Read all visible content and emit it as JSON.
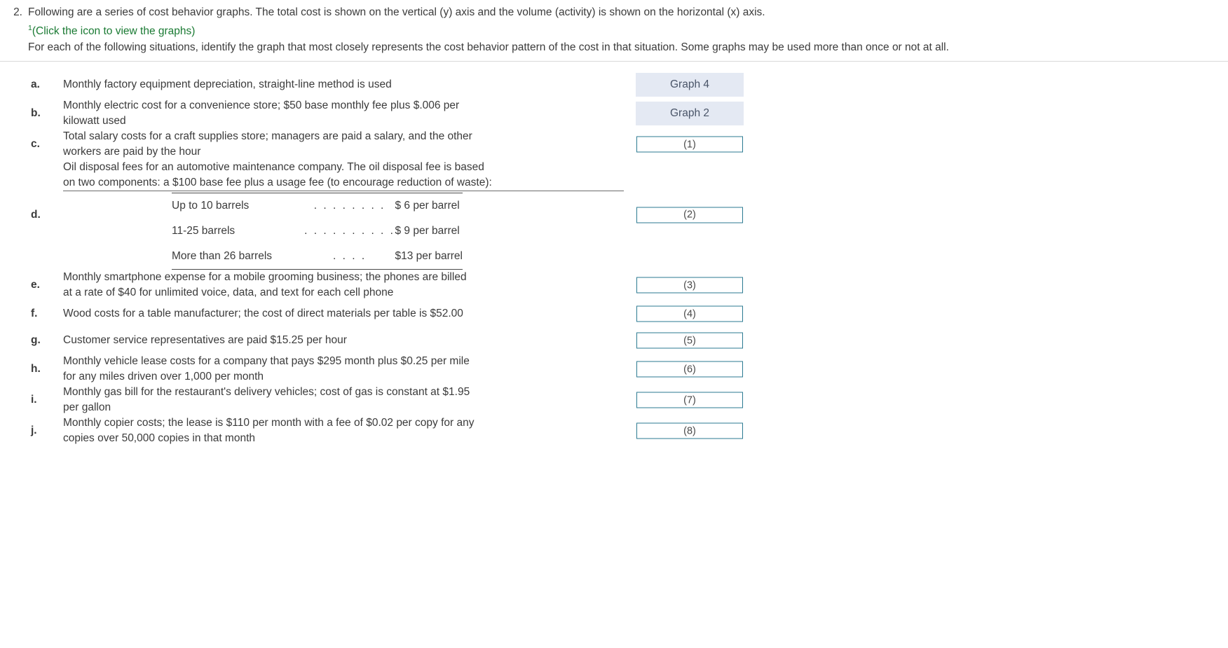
{
  "question": {
    "number": "2.",
    "intro_line": "Following are a series of cost behavior graphs. The total cost is shown on the vertical (y) axis and the volume (activity) is shown on the horizontal (x) axis.",
    "hint_superscript": "1",
    "hint_text": "(Click the icon to view the graphs)",
    "instruction_line": "For each of the following situations, identify the graph that most closely represents the cost behavior pattern of the cost in that situation. Some graphs may be used more than once or not at all."
  },
  "items": [
    {
      "label": "a.",
      "lines": [
        "Monthly factory equipment depreciation, straight-line method is used"
      ],
      "answer": {
        "type": "filled",
        "value": "Graph 4"
      }
    },
    {
      "label": "b.",
      "lines": [
        "Monthly electric cost for a convenience store; $50 base monthly fee plus $.006 per",
        "kilowatt used"
      ],
      "answer": {
        "type": "filled",
        "value": "Graph 2"
      }
    },
    {
      "label": "c.",
      "lines": [
        "Total salary costs for a craft supplies store; managers are paid a salary, and the other",
        "workers are paid by the hour"
      ],
      "answer": {
        "type": "input",
        "value": "(1)"
      }
    },
    {
      "label": "d.",
      "lines": [
        "Oil disposal fees for an automotive maintenance company. The oil disposal fee is based",
        "on two components: a $100 base fee plus a usage fee (to encourage reduction of waste):"
      ],
      "answer": {
        "type": "input",
        "value": "(2)"
      },
      "subtable": {
        "rows": [
          {
            "label": "Up to 10 barrels",
            "dots": ". . . . . . . .",
            "value": "$ 6 per barrel"
          },
          {
            "label": "11-25 barrels",
            "dots": ". . . . . . . . . .",
            "value": "$ 9 per barrel"
          },
          {
            "label": "More than 26 barrels",
            "dots": ". . . .",
            "value": "$13 per barrel"
          }
        ]
      }
    },
    {
      "label": "e.",
      "lines": [
        "Monthly smartphone expense for a mobile grooming business; the phones are billed",
        "at a rate of $40 for unlimited voice, data, and text for each cell phone"
      ],
      "answer": {
        "type": "input",
        "value": "(3)"
      }
    },
    {
      "label": "f.",
      "lines": [
        "Wood costs for a table manufacturer; the cost of direct materials per table is $52.00"
      ],
      "answer": {
        "type": "input",
        "value": "(4)"
      }
    },
    {
      "label": "g.",
      "lines": [
        "Customer service representatives are paid $15.25 per hour"
      ],
      "answer": {
        "type": "input",
        "value": "(5)"
      }
    },
    {
      "label": "h.",
      "lines": [
        "Monthly vehicle lease costs for a company that pays $295 month plus $0.25 per mile",
        "for any miles driven over 1,000 per month"
      ],
      "answer": {
        "type": "input",
        "value": "(6)"
      }
    },
    {
      "label": "i.",
      "lines": [
        "Monthly gas bill for the restaurant's delivery vehicles; cost of gas is constant at $1.95",
        "per gallon"
      ],
      "answer": {
        "type": "input",
        "value": "(7)"
      }
    },
    {
      "label": "j.",
      "lines": [
        "Monthly copier costs; the lease is $110 per month with a fee of $0.02 per copy for any",
        "copies over 50,000 copies in that month"
      ],
      "answer": {
        "type": "input",
        "value": "(8)"
      }
    }
  ],
  "colors": {
    "text": "#3b3b3b",
    "hint_link": "#1a7a33",
    "filled_answer_bg": "#e4e9f3",
    "input_border": "#2b7a91",
    "divider": "#d9d9d9"
  }
}
